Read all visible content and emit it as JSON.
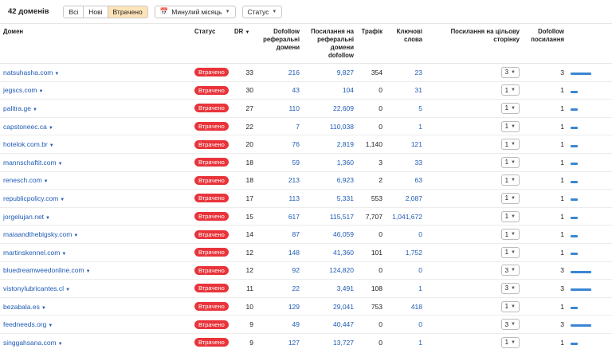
{
  "toolbar": {
    "count": "42 доменів",
    "filters": [
      "Всі",
      "Нові",
      "Втрачено"
    ],
    "active_filter": 2,
    "period": "Минулий місяць",
    "status": "Статус"
  },
  "columns": {
    "domain": "Домен",
    "status": "Статус",
    "dr": "DR",
    "dofollow_ref": "Dofollow реферальні домени",
    "links_ref": "Посилання на реферальні домени dofollow",
    "traffic": "Трафік",
    "keywords": "Ключові слова",
    "links_target": "Посилання на цільову сторінку",
    "dofollow_links": "Dofollow посилання"
  },
  "status_label": "Втрачено",
  "rows": [
    {
      "domain": "natsuhasha.com",
      "dr": "33",
      "ref": "216",
      "links": "9,827",
      "traffic": "354",
      "kw": "23",
      "target": "3",
      "dofollow": "3",
      "fill": 1.0
    },
    {
      "domain": "jegscs.com",
      "dr": "30",
      "ref": "43",
      "links": "104",
      "traffic": "0",
      "kw": "31",
      "target": "1",
      "dofollow": "1",
      "fill": 0.333
    },
    {
      "domain": "palitra.ge",
      "dr": "27",
      "ref": "110",
      "links": "22,609",
      "traffic": "0",
      "kw": "5",
      "target": "1",
      "dofollow": "1",
      "fill": 0.333
    },
    {
      "domain": "capstoneec.ca",
      "dr": "22",
      "ref": "7",
      "links": "110,038",
      "traffic": "0",
      "kw": "1",
      "target": "1",
      "dofollow": "1",
      "fill": 0.333
    },
    {
      "domain": "hotelok.com.br",
      "dr": "20",
      "ref": "76",
      "links": "2,819",
      "traffic": "1,140",
      "kw": "121",
      "target": "1",
      "dofollow": "1",
      "fill": 0.333
    },
    {
      "domain": "mannschaftit.com",
      "dr": "18",
      "ref": "59",
      "links": "1,360",
      "traffic": "3",
      "kw": "33",
      "target": "1",
      "dofollow": "1",
      "fill": 0.333
    },
    {
      "domain": "renesch.com",
      "dr": "18",
      "ref": "213",
      "links": "6,923",
      "traffic": "2",
      "kw": "63",
      "target": "1",
      "dofollow": "1",
      "fill": 0.333
    },
    {
      "domain": "republicpolicy.com",
      "dr": "17",
      "ref": "113",
      "links": "5,331",
      "traffic": "553",
      "kw": "2,087",
      "target": "1",
      "dofollow": "1",
      "fill": 0.333
    },
    {
      "domain": "jorgelujan.net",
      "dr": "15",
      "ref": "617",
      "links": "115,517",
      "traffic": "7,707",
      "kw": "1,041,672",
      "target": "1",
      "dofollow": "1",
      "fill": 0.333
    },
    {
      "domain": "maiaandthebigsky.com",
      "dr": "14",
      "ref": "87",
      "links": "46,059",
      "traffic": "0",
      "kw": "0",
      "target": "1",
      "dofollow": "1",
      "fill": 0.333
    },
    {
      "domain": "martinskennel.com",
      "dr": "12",
      "ref": "148",
      "links": "41,360",
      "traffic": "101",
      "kw": "1,752",
      "target": "1",
      "dofollow": "1",
      "fill": 0.333
    },
    {
      "domain": "bluedreamweedonline.com",
      "dr": "12",
      "ref": "92",
      "links": "124,820",
      "traffic": "0",
      "kw": "0",
      "target": "3",
      "dofollow": "3",
      "fill": 1.0
    },
    {
      "domain": "vistonylubricantes.cl",
      "dr": "11",
      "ref": "22",
      "links": "3,491",
      "traffic": "108",
      "kw": "1",
      "target": "3",
      "dofollow": "3",
      "fill": 1.0
    },
    {
      "domain": "bezabala.es",
      "dr": "10",
      "ref": "129",
      "links": "29,041",
      "traffic": "753",
      "kw": "418",
      "target": "1",
      "dofollow": "1",
      "fill": 0.333
    },
    {
      "domain": "feedneeds.org",
      "dr": "9",
      "ref": "49",
      "links": "40,447",
      "traffic": "0",
      "kw": "0",
      "target": "3",
      "dofollow": "3",
      "fill": 1.0
    },
    {
      "domain": "singgahsana.com",
      "dr": "9",
      "ref": "127",
      "links": "13,727",
      "traffic": "0",
      "kw": "1",
      "target": "1",
      "dofollow": "1",
      "fill": 0.333
    }
  ],
  "colors": {
    "accent": "#1f5bb5",
    "badge": "#e8343a",
    "bar": "#3a86d4",
    "active_filter": "#fde3b8"
  }
}
